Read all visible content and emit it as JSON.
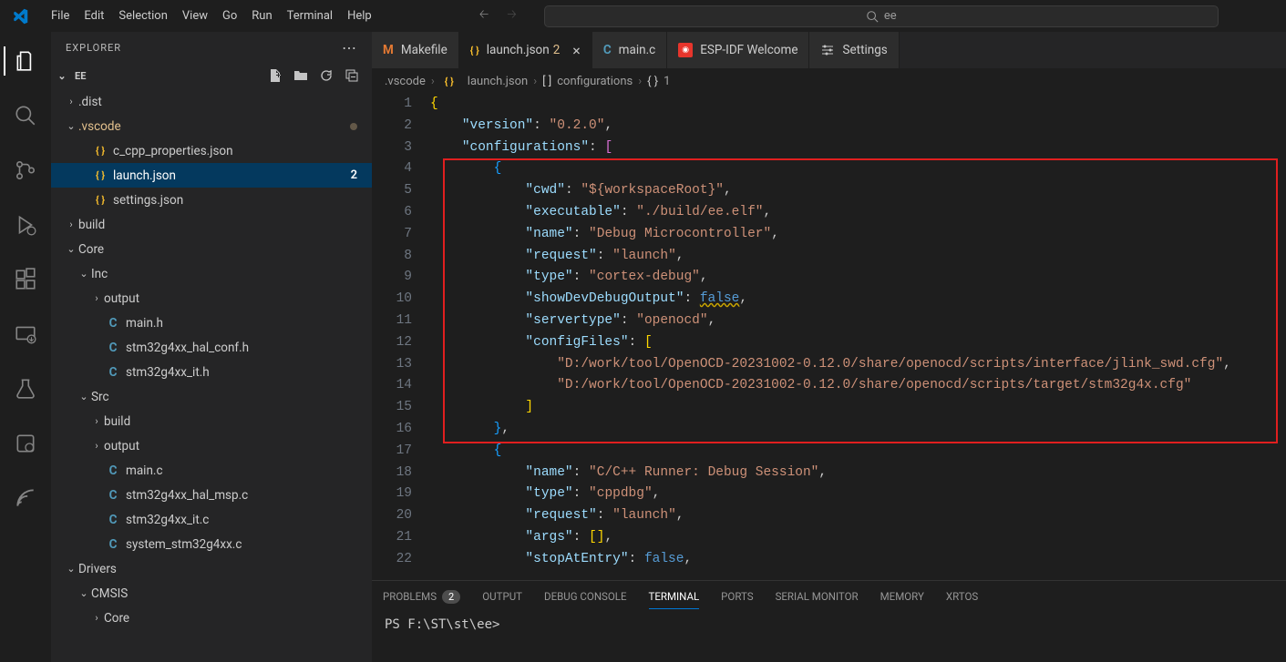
{
  "menu": [
    "File",
    "Edit",
    "Selection",
    "View",
    "Go",
    "Run",
    "Terminal",
    "Help"
  ],
  "search": {
    "placeholder": "ee"
  },
  "sidebar": {
    "title": "EXPLORER",
    "section": "EE",
    "tree": [
      {
        "indent": 1,
        "type": "folder",
        "open": false,
        "label": ".dist"
      },
      {
        "indent": 1,
        "type": "folder",
        "open": true,
        "label": ".vscode",
        "modified": true
      },
      {
        "indent": 2,
        "type": "file",
        "icon": "json",
        "label": "c_cpp_properties.json"
      },
      {
        "indent": 2,
        "type": "file",
        "icon": "json",
        "label": "launch.json",
        "active": true,
        "badge": "2"
      },
      {
        "indent": 2,
        "type": "file",
        "icon": "json",
        "label": "settings.json"
      },
      {
        "indent": 1,
        "type": "folder",
        "open": false,
        "label": "build"
      },
      {
        "indent": 1,
        "type": "folder",
        "open": true,
        "label": "Core"
      },
      {
        "indent": 2,
        "type": "folder",
        "open": true,
        "label": "Inc"
      },
      {
        "indent": 3,
        "type": "folder",
        "open": false,
        "label": "output"
      },
      {
        "indent": 3,
        "type": "file",
        "icon": "c",
        "label": "main.h"
      },
      {
        "indent": 3,
        "type": "file",
        "icon": "c",
        "label": "stm32g4xx_hal_conf.h"
      },
      {
        "indent": 3,
        "type": "file",
        "icon": "c",
        "label": "stm32g4xx_it.h"
      },
      {
        "indent": 2,
        "type": "folder",
        "open": true,
        "label": "Src"
      },
      {
        "indent": 3,
        "type": "folder",
        "open": false,
        "label": "build"
      },
      {
        "indent": 3,
        "type": "folder",
        "open": false,
        "label": "output"
      },
      {
        "indent": 3,
        "type": "file",
        "icon": "c",
        "label": "main.c"
      },
      {
        "indent": 3,
        "type": "file",
        "icon": "c",
        "label": "stm32g4xx_hal_msp.c"
      },
      {
        "indent": 3,
        "type": "file",
        "icon": "c",
        "label": "stm32g4xx_it.c"
      },
      {
        "indent": 3,
        "type": "file",
        "icon": "c",
        "label": "system_stm32g4xx.c"
      },
      {
        "indent": 1,
        "type": "folder",
        "open": true,
        "label": "Drivers"
      },
      {
        "indent": 2,
        "type": "folder",
        "open": true,
        "label": "CMSIS"
      },
      {
        "indent": 3,
        "type": "folder",
        "open": false,
        "label": "Core"
      }
    ]
  },
  "tabs": [
    {
      "icon": "m",
      "label": "Makefile"
    },
    {
      "icon": "json",
      "label": "launch.json",
      "suffix": "2",
      "active": true,
      "close": true
    },
    {
      "icon": "c",
      "label": "main.c",
      "styleItalic": true
    },
    {
      "icon": "espidf",
      "label": "ESP-IDF Welcome"
    },
    {
      "icon": "settings",
      "label": "Settings"
    }
  ],
  "breadcrumb": [
    ".vscode",
    "launch.json",
    "configurations",
    "1"
  ],
  "code": {
    "lines": [
      {
        "n": 1,
        "tokens": [
          [
            "brace",
            "{"
          ]
        ]
      },
      {
        "n": 2,
        "tokens": [
          [
            "sp",
            "    "
          ],
          [
            "key",
            "\"version\""
          ],
          [
            "punc",
            ": "
          ],
          [
            "str",
            "\"0.2.0\""
          ],
          [
            "punc",
            ","
          ]
        ]
      },
      {
        "n": 3,
        "tokens": [
          [
            "sp",
            "    "
          ],
          [
            "key",
            "\"configurations\""
          ],
          [
            "punc",
            ": "
          ],
          [
            "brace2",
            "["
          ]
        ]
      },
      {
        "n": 4,
        "tokens": [
          [
            "sp",
            "        "
          ],
          [
            "brace3",
            "{"
          ]
        ]
      },
      {
        "n": 5,
        "tokens": [
          [
            "sp",
            "            "
          ],
          [
            "key",
            "\"cwd\""
          ],
          [
            "punc",
            ": "
          ],
          [
            "str",
            "\"${workspaceRoot}\""
          ],
          [
            "punc",
            ","
          ]
        ]
      },
      {
        "n": 6,
        "tokens": [
          [
            "sp",
            "            "
          ],
          [
            "key",
            "\"executable\""
          ],
          [
            "punc",
            ": "
          ],
          [
            "str",
            "\"./build/ee.elf\""
          ],
          [
            "punc",
            ","
          ]
        ]
      },
      {
        "n": 7,
        "tokens": [
          [
            "sp",
            "            "
          ],
          [
            "key",
            "\"name\""
          ],
          [
            "punc",
            ": "
          ],
          [
            "str",
            "\"Debug Microcontroller\""
          ],
          [
            "punc",
            ","
          ]
        ]
      },
      {
        "n": 8,
        "tokens": [
          [
            "sp",
            "            "
          ],
          [
            "key",
            "\"request\""
          ],
          [
            "punc",
            ": "
          ],
          [
            "str",
            "\"launch\""
          ],
          [
            "punc",
            ","
          ]
        ]
      },
      {
        "n": 9,
        "tokens": [
          [
            "sp",
            "            "
          ],
          [
            "key",
            "\"type\""
          ],
          [
            "punc",
            ": "
          ],
          [
            "str",
            "\"cortex-debug\""
          ],
          [
            "punc",
            ","
          ]
        ]
      },
      {
        "n": 10,
        "tokens": [
          [
            "sp",
            "            "
          ],
          [
            "key",
            "\"showDevDebugOutput\""
          ],
          [
            "punc",
            ": "
          ],
          [
            "bool",
            "false",
            "squiggle"
          ],
          [
            "punc",
            ","
          ]
        ]
      },
      {
        "n": 11,
        "tokens": [
          [
            "sp",
            "            "
          ],
          [
            "key",
            "\"servertype\""
          ],
          [
            "punc",
            ": "
          ],
          [
            "str",
            "\"openocd\""
          ],
          [
            "punc",
            ","
          ]
        ]
      },
      {
        "n": 12,
        "tokens": [
          [
            "sp",
            "            "
          ],
          [
            "key",
            "\"configFiles\""
          ],
          [
            "punc",
            ": "
          ],
          [
            "brace",
            "["
          ]
        ]
      },
      {
        "n": 13,
        "tokens": [
          [
            "sp",
            "                "
          ],
          [
            "str",
            "\"D:/work/tool/OpenOCD-20231002-0.12.0/share/openocd/scripts/interface/jlink_swd.cfg\""
          ],
          [
            "punc",
            ","
          ]
        ]
      },
      {
        "n": 14,
        "tokens": [
          [
            "sp",
            "                "
          ],
          [
            "str",
            "\"D:/work/tool/OpenOCD-20231002-0.12.0/share/openocd/scripts/target/stm32g4x.cfg\""
          ]
        ]
      },
      {
        "n": 15,
        "tokens": [
          [
            "sp",
            "            "
          ],
          [
            "brace",
            "]"
          ]
        ]
      },
      {
        "n": 16,
        "tokens": [
          [
            "sp",
            "        "
          ],
          [
            "brace3",
            "}"
          ],
          [
            "punc",
            ","
          ]
        ]
      },
      {
        "n": 17,
        "tokens": [
          [
            "sp",
            "        "
          ],
          [
            "brace3",
            "{"
          ]
        ]
      },
      {
        "n": 18,
        "tokens": [
          [
            "sp",
            "            "
          ],
          [
            "key",
            "\"name\""
          ],
          [
            "punc",
            ": "
          ],
          [
            "str",
            "\"C/C++ Runner: Debug Session\""
          ],
          [
            "punc",
            ","
          ]
        ]
      },
      {
        "n": 19,
        "tokens": [
          [
            "sp",
            "            "
          ],
          [
            "key",
            "\"type\""
          ],
          [
            "punc",
            ": "
          ],
          [
            "str",
            "\"cppdbg\""
          ],
          [
            "punc",
            ","
          ]
        ]
      },
      {
        "n": 20,
        "tokens": [
          [
            "sp",
            "            "
          ],
          [
            "key",
            "\"request\""
          ],
          [
            "punc",
            ": "
          ],
          [
            "str",
            "\"launch\""
          ],
          [
            "punc",
            ","
          ]
        ]
      },
      {
        "n": 21,
        "tokens": [
          [
            "sp",
            "            "
          ],
          [
            "key",
            "\"args\""
          ],
          [
            "punc",
            ": "
          ],
          [
            "brace",
            "["
          ],
          [
            "brace",
            "]"
          ],
          [
            "punc",
            ","
          ]
        ]
      },
      {
        "n": 22,
        "tokens": [
          [
            "sp",
            "            "
          ],
          [
            "key",
            "\"stopAtEntry\""
          ],
          [
            "punc",
            ": "
          ],
          [
            "bool",
            "false"
          ],
          [
            "punc",
            ","
          ]
        ]
      }
    ]
  },
  "panel": {
    "tabs": [
      {
        "label": "PROBLEMS",
        "count": "2"
      },
      {
        "label": "OUTPUT"
      },
      {
        "label": "DEBUG CONSOLE"
      },
      {
        "label": "TERMINAL",
        "active": true
      },
      {
        "label": "PORTS"
      },
      {
        "label": "SERIAL MONITOR"
      },
      {
        "label": "MEMORY"
      },
      {
        "label": "XRTOS"
      }
    ],
    "terminal": "PS F:\\ST\\st\\ee>"
  }
}
